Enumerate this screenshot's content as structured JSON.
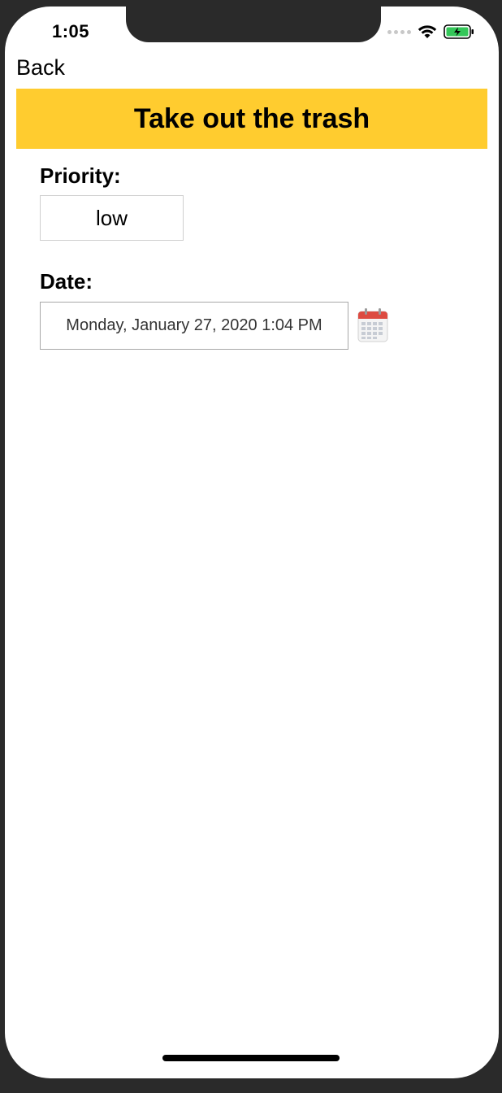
{
  "status_bar": {
    "time": "1:05"
  },
  "nav": {
    "back_label": "Back"
  },
  "header": {
    "title": "Take out the trash",
    "bg_color": "#ffcc2f"
  },
  "priority": {
    "label": "Priority:",
    "value": "low"
  },
  "date": {
    "label": "Date:",
    "value": "Monday, January 27, 2020 1:04 PM",
    "picker_icon": "calendar-icon"
  }
}
